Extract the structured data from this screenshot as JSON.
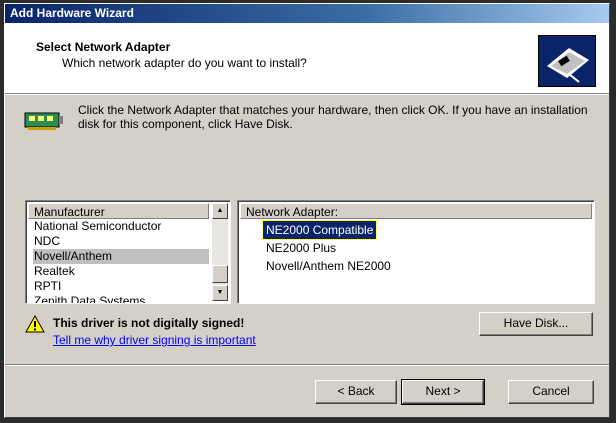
{
  "window": {
    "title": "Add Hardware Wizard"
  },
  "header": {
    "title": "Select Network Adapter",
    "subtitle": "Which network adapter do you want to install?"
  },
  "info": {
    "text": "Click the Network Adapter that matches your hardware, then click OK. If you have an installation disk for this component, click Have Disk."
  },
  "manufacturer": {
    "header": "Manufacturer",
    "items": [
      {
        "label": "National Semiconductor"
      },
      {
        "label": "NDC"
      },
      {
        "label": "Novell/Anthem"
      },
      {
        "label": "Realtek"
      },
      {
        "label": "RPTI"
      },
      {
        "label": "Zenith Data Systems"
      }
    ],
    "selected_index": 2
  },
  "adapter": {
    "header": "Network Adapter:",
    "items": [
      {
        "label": "NE2000 Compatible"
      },
      {
        "label": "NE2000 Plus"
      },
      {
        "label": "Novell/Anthem NE2000"
      }
    ],
    "selected_index": 0
  },
  "warning": {
    "text": "This driver is not digitally signed!",
    "link": "Tell me why driver signing is important"
  },
  "buttons": {
    "have_disk": "Have Disk...",
    "back": "< Back",
    "next": "Next >",
    "cancel": "Cancel"
  },
  "colors": {
    "titlebar": "#0a246a",
    "selection": "#0a246a",
    "link": "#0000ff",
    "face": "#d4d0c8"
  }
}
